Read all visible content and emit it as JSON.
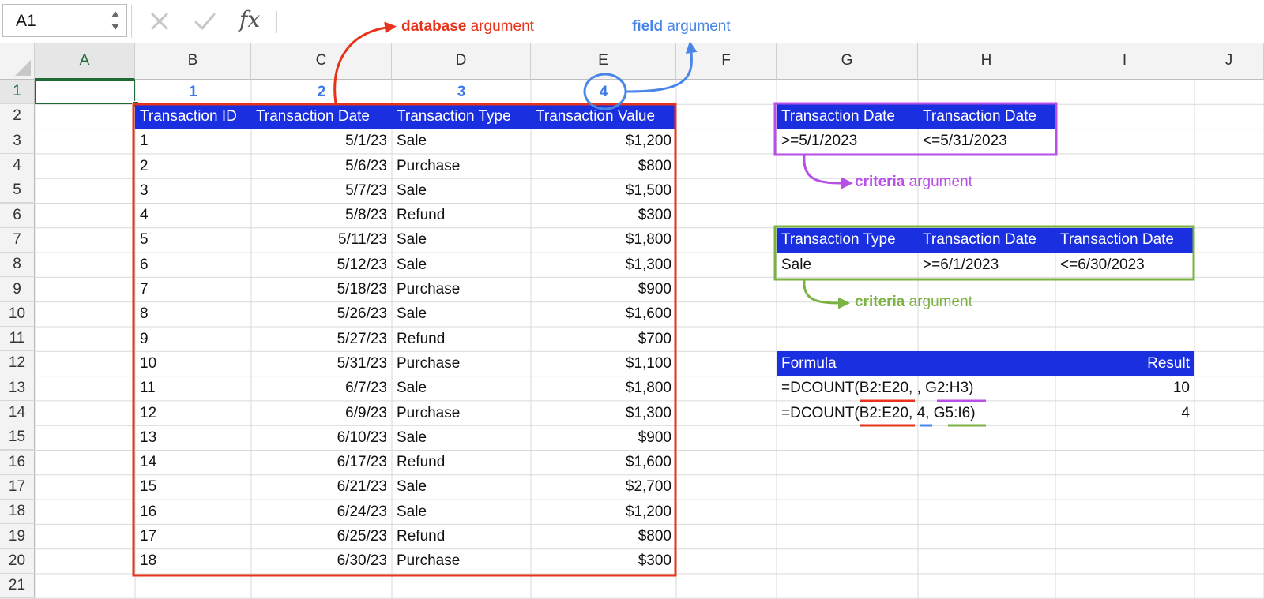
{
  "name_box": "A1",
  "formula_bar": {
    "cancel_icon": "x-icon",
    "enter_icon": "check-icon",
    "fx_label": "fx"
  },
  "columns": [
    "A",
    "B",
    "C",
    "D",
    "E",
    "F",
    "G",
    "H",
    "I",
    "J"
  ],
  "rows": [
    "1",
    "2",
    "3",
    "4",
    "5",
    "6",
    "7",
    "8",
    "9",
    "10",
    "11",
    "12",
    "13",
    "14",
    "15",
    "16",
    "17",
    "18",
    "19",
    "20",
    "21"
  ],
  "field_numbers": [
    "1",
    "2",
    "3",
    "4"
  ],
  "database": {
    "headers": [
      "Transaction ID",
      "Transaction Date",
      "Transaction Type",
      "Transaction Value"
    ],
    "rows": [
      [
        "1",
        "5/1/23",
        "Sale",
        "$1,200"
      ],
      [
        "2",
        "5/6/23",
        "Purchase",
        "$800"
      ],
      [
        "3",
        "5/7/23",
        "Sale",
        "$1,500"
      ],
      [
        "4",
        "5/8/23",
        "Refund",
        "$300"
      ],
      [
        "5",
        "5/11/23",
        "Sale",
        "$1,800"
      ],
      [
        "6",
        "5/12/23",
        "Sale",
        "$1,300"
      ],
      [
        "7",
        "5/18/23",
        "Purchase",
        "$900"
      ],
      [
        "8",
        "5/26/23",
        "Sale",
        "$1,600"
      ],
      [
        "9",
        "5/27/23",
        "Refund",
        "$700"
      ],
      [
        "10",
        "5/31/23",
        "Purchase",
        "$1,100"
      ],
      [
        "11",
        "6/7/23",
        "Sale",
        "$1,800"
      ],
      [
        "12",
        "6/9/23",
        "Purchase",
        "$1,300"
      ],
      [
        "13",
        "6/10/23",
        "Sale",
        "$900"
      ],
      [
        "14",
        "6/17/23",
        "Refund",
        "$1,600"
      ],
      [
        "15",
        "6/21/23",
        "Sale",
        "$2,700"
      ],
      [
        "16",
        "6/24/23",
        "Sale",
        "$1,200"
      ],
      [
        "17",
        "6/25/23",
        "Refund",
        "$800"
      ],
      [
        "18",
        "6/30/23",
        "Purchase",
        "$300"
      ]
    ]
  },
  "criteria1": {
    "headers": [
      "Transaction Date",
      "Transaction Date"
    ],
    "values": [
      ">=5/1/2023",
      "<=5/31/2023"
    ]
  },
  "criteria2": {
    "headers": [
      "Transaction Type",
      "Transaction Date",
      "Transaction Date"
    ],
    "values": [
      "Sale",
      ">=6/1/2023",
      "<=6/30/2023"
    ]
  },
  "formulas": {
    "headers": [
      "Formula",
      "Result"
    ],
    "rows": [
      {
        "parts": [
          "=DCOUNT(",
          "B2:E20",
          ", , ",
          "G2:H3",
          ")"
        ],
        "result": "10"
      },
      {
        "parts": [
          "=DCOUNT(",
          "B2:E20",
          ", ",
          "4",
          ", ",
          "G5:I6",
          ")"
        ],
        "result": "4"
      }
    ]
  },
  "annotations": {
    "database": {
      "bold": "database",
      "rest": " argument"
    },
    "field": {
      "bold": "field",
      "rest": " argument"
    },
    "criteria1": {
      "bold": "criteria",
      "rest": " argument"
    },
    "criteria2": {
      "bold": "criteria",
      "rest": " argument"
    }
  },
  "colors": {
    "header_fill": "#1a2fe0",
    "database_red": "#e8331c",
    "field_blue": "#4a86e8",
    "criteria_purple": "#b84fe6",
    "criteria_green": "#7bb241",
    "selection_green": "#1e6b33"
  }
}
